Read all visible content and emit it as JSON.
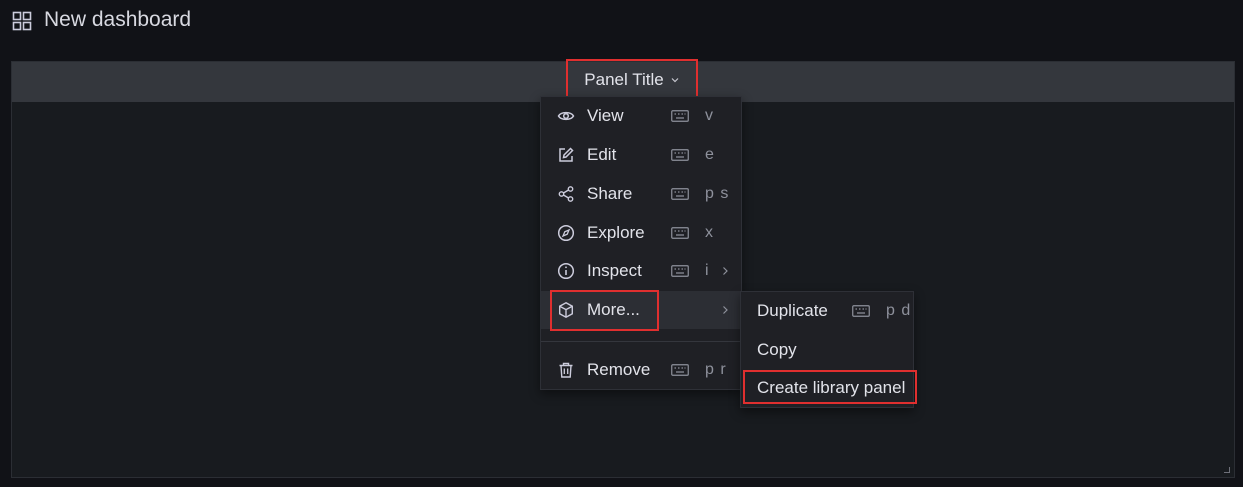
{
  "dashboard": {
    "title": "New dashboard",
    "icon": "apps-grid-icon"
  },
  "panel": {
    "title": "Panel Title"
  },
  "menu": {
    "items": [
      {
        "label": "View",
        "shortcut": "v",
        "icon": "eye-icon"
      },
      {
        "label": "Edit",
        "shortcut": "e",
        "icon": "edit-icon"
      },
      {
        "label": "Share",
        "shortcut": "p s",
        "icon": "share-icon"
      },
      {
        "label": "Explore",
        "shortcut": "x",
        "icon": "compass-icon"
      },
      {
        "label": "Inspect",
        "shortcut": "i",
        "icon": "info-icon"
      },
      {
        "label": "More...",
        "shortcut": "",
        "icon": "cube-icon"
      },
      {
        "label": "Remove",
        "shortcut": "p r",
        "icon": "trash-icon"
      }
    ]
  },
  "submenu": {
    "items": [
      {
        "label": "Duplicate",
        "shortcut": "p d"
      },
      {
        "label": "Copy",
        "shortcut": ""
      },
      {
        "label": "Create library panel",
        "shortcut": ""
      }
    ]
  },
  "colors": {
    "highlight": "#e02f2f",
    "background": "#111217",
    "panel": "#181b1f",
    "menu": "#1f2025"
  }
}
